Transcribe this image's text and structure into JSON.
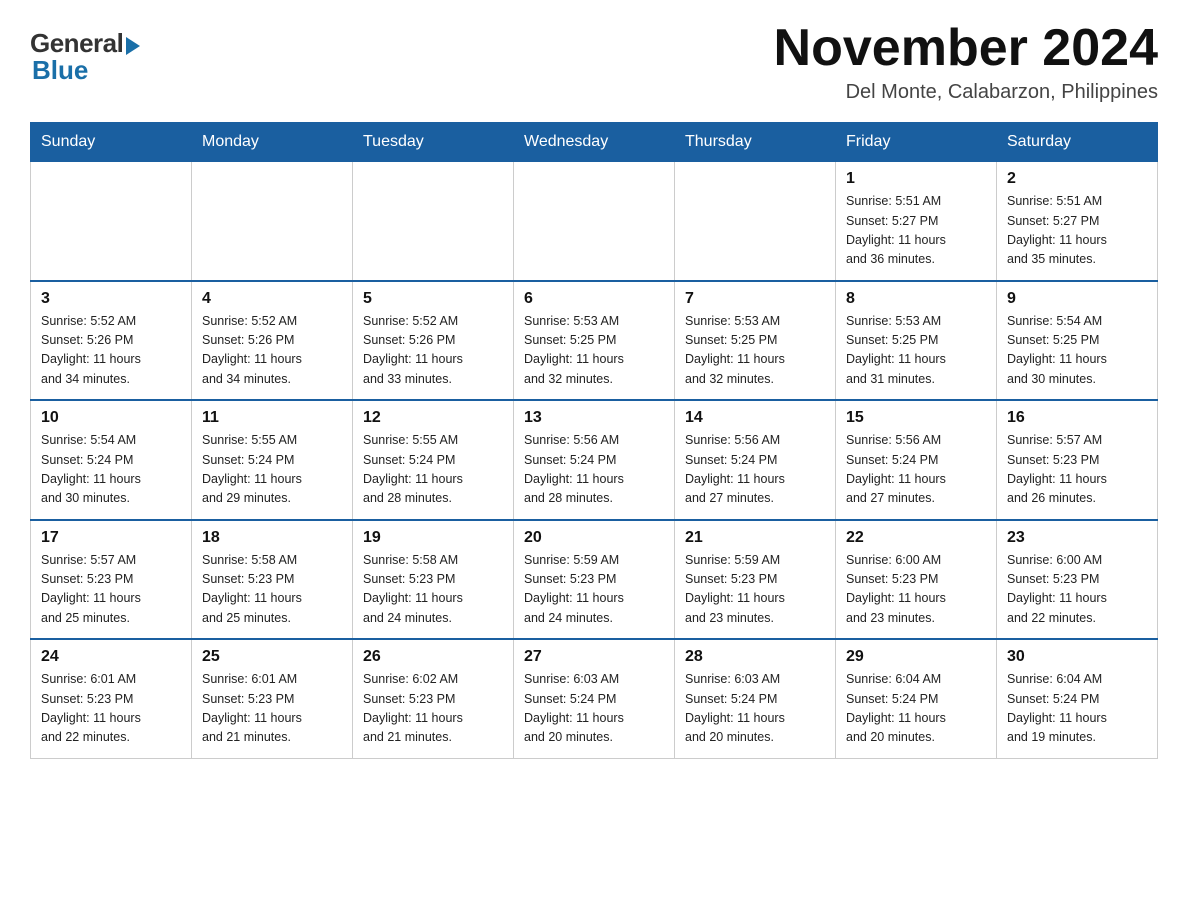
{
  "logo": {
    "general": "General",
    "blue": "Blue"
  },
  "title": "November 2024",
  "location": "Del Monte, Calabarzon, Philippines",
  "days_of_week": [
    "Sunday",
    "Monday",
    "Tuesday",
    "Wednesday",
    "Thursday",
    "Friday",
    "Saturday"
  ],
  "weeks": [
    [
      {
        "day": "",
        "info": ""
      },
      {
        "day": "",
        "info": ""
      },
      {
        "day": "",
        "info": ""
      },
      {
        "day": "",
        "info": ""
      },
      {
        "day": "",
        "info": ""
      },
      {
        "day": "1",
        "info": "Sunrise: 5:51 AM\nSunset: 5:27 PM\nDaylight: 11 hours\nand 36 minutes."
      },
      {
        "day": "2",
        "info": "Sunrise: 5:51 AM\nSunset: 5:27 PM\nDaylight: 11 hours\nand 35 minutes."
      }
    ],
    [
      {
        "day": "3",
        "info": "Sunrise: 5:52 AM\nSunset: 5:26 PM\nDaylight: 11 hours\nand 34 minutes."
      },
      {
        "day": "4",
        "info": "Sunrise: 5:52 AM\nSunset: 5:26 PM\nDaylight: 11 hours\nand 34 minutes."
      },
      {
        "day": "5",
        "info": "Sunrise: 5:52 AM\nSunset: 5:26 PM\nDaylight: 11 hours\nand 33 minutes."
      },
      {
        "day": "6",
        "info": "Sunrise: 5:53 AM\nSunset: 5:25 PM\nDaylight: 11 hours\nand 32 minutes."
      },
      {
        "day": "7",
        "info": "Sunrise: 5:53 AM\nSunset: 5:25 PM\nDaylight: 11 hours\nand 32 minutes."
      },
      {
        "day": "8",
        "info": "Sunrise: 5:53 AM\nSunset: 5:25 PM\nDaylight: 11 hours\nand 31 minutes."
      },
      {
        "day": "9",
        "info": "Sunrise: 5:54 AM\nSunset: 5:25 PM\nDaylight: 11 hours\nand 30 minutes."
      }
    ],
    [
      {
        "day": "10",
        "info": "Sunrise: 5:54 AM\nSunset: 5:24 PM\nDaylight: 11 hours\nand 30 minutes."
      },
      {
        "day": "11",
        "info": "Sunrise: 5:55 AM\nSunset: 5:24 PM\nDaylight: 11 hours\nand 29 minutes."
      },
      {
        "day": "12",
        "info": "Sunrise: 5:55 AM\nSunset: 5:24 PM\nDaylight: 11 hours\nand 28 minutes."
      },
      {
        "day": "13",
        "info": "Sunrise: 5:56 AM\nSunset: 5:24 PM\nDaylight: 11 hours\nand 28 minutes."
      },
      {
        "day": "14",
        "info": "Sunrise: 5:56 AM\nSunset: 5:24 PM\nDaylight: 11 hours\nand 27 minutes."
      },
      {
        "day": "15",
        "info": "Sunrise: 5:56 AM\nSunset: 5:24 PM\nDaylight: 11 hours\nand 27 minutes."
      },
      {
        "day": "16",
        "info": "Sunrise: 5:57 AM\nSunset: 5:23 PM\nDaylight: 11 hours\nand 26 minutes."
      }
    ],
    [
      {
        "day": "17",
        "info": "Sunrise: 5:57 AM\nSunset: 5:23 PM\nDaylight: 11 hours\nand 25 minutes."
      },
      {
        "day": "18",
        "info": "Sunrise: 5:58 AM\nSunset: 5:23 PM\nDaylight: 11 hours\nand 25 minutes."
      },
      {
        "day": "19",
        "info": "Sunrise: 5:58 AM\nSunset: 5:23 PM\nDaylight: 11 hours\nand 24 minutes."
      },
      {
        "day": "20",
        "info": "Sunrise: 5:59 AM\nSunset: 5:23 PM\nDaylight: 11 hours\nand 24 minutes."
      },
      {
        "day": "21",
        "info": "Sunrise: 5:59 AM\nSunset: 5:23 PM\nDaylight: 11 hours\nand 23 minutes."
      },
      {
        "day": "22",
        "info": "Sunrise: 6:00 AM\nSunset: 5:23 PM\nDaylight: 11 hours\nand 23 minutes."
      },
      {
        "day": "23",
        "info": "Sunrise: 6:00 AM\nSunset: 5:23 PM\nDaylight: 11 hours\nand 22 minutes."
      }
    ],
    [
      {
        "day": "24",
        "info": "Sunrise: 6:01 AM\nSunset: 5:23 PM\nDaylight: 11 hours\nand 22 minutes."
      },
      {
        "day": "25",
        "info": "Sunrise: 6:01 AM\nSunset: 5:23 PM\nDaylight: 11 hours\nand 21 minutes."
      },
      {
        "day": "26",
        "info": "Sunrise: 6:02 AM\nSunset: 5:23 PM\nDaylight: 11 hours\nand 21 minutes."
      },
      {
        "day": "27",
        "info": "Sunrise: 6:03 AM\nSunset: 5:24 PM\nDaylight: 11 hours\nand 20 minutes."
      },
      {
        "day": "28",
        "info": "Sunrise: 6:03 AM\nSunset: 5:24 PM\nDaylight: 11 hours\nand 20 minutes."
      },
      {
        "day": "29",
        "info": "Sunrise: 6:04 AM\nSunset: 5:24 PM\nDaylight: 11 hours\nand 20 minutes."
      },
      {
        "day": "30",
        "info": "Sunrise: 6:04 AM\nSunset: 5:24 PM\nDaylight: 11 hours\nand 19 minutes."
      }
    ]
  ]
}
